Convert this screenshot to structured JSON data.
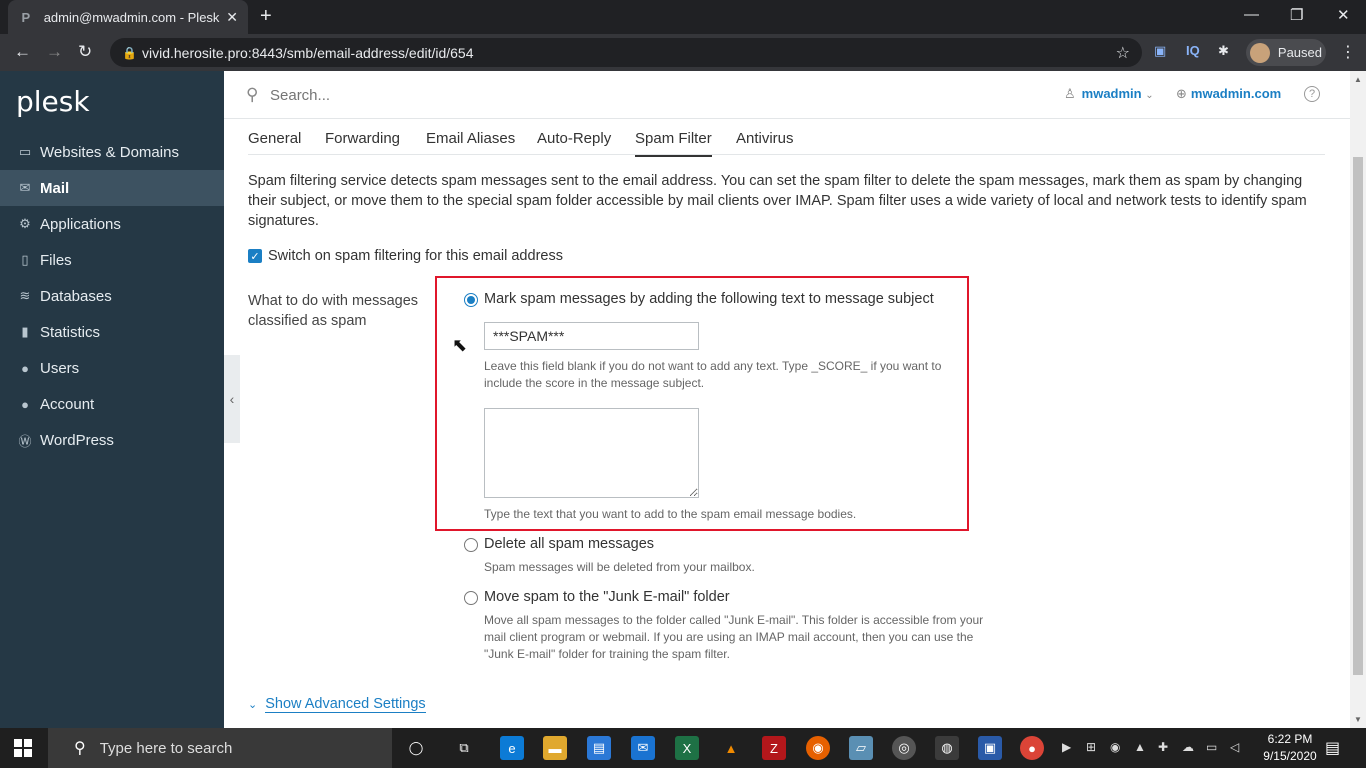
{
  "browser": {
    "tab_title": "admin@mwadmin.com - Plesk O",
    "tab_favicon": "P",
    "url": "vivid.herosite.pro:8443/smb/email-address/edit/id/654",
    "profile_status": "Paused",
    "extensions": [
      "IQ"
    ]
  },
  "sidebar": {
    "logo": "plesk",
    "items": [
      {
        "label": "Websites & Domains",
        "icon": "monitor-icon"
      },
      {
        "label": "Mail",
        "icon": "envelope-icon"
      },
      {
        "label": "Applications",
        "icon": "gear-icon"
      },
      {
        "label": "Files",
        "icon": "file-icon"
      },
      {
        "label": "Databases",
        "icon": "layers-icon"
      },
      {
        "label": "Statistics",
        "icon": "bar-chart-icon"
      },
      {
        "label": "Users",
        "icon": "user-icon"
      },
      {
        "label": "Account",
        "icon": "user-icon"
      },
      {
        "label": "WordPress",
        "icon": "wordpress-icon"
      }
    ]
  },
  "header": {
    "search_placeholder": "Search...",
    "user": "mwadmin",
    "domain": "mwadmin.com"
  },
  "page": {
    "tabs": [
      "General",
      "Forwarding",
      "Email Aliases",
      "Auto-Reply",
      "Spam Filter",
      "Antivirus"
    ],
    "active_tab": "Spam Filter",
    "description": "Spam filtering service detects spam messages sent to the email address. You can set the spam filter to delete the spam messages, mark them as spam by changing their subject, or move them to the special spam folder accessible by mail clients over IMAP. Spam filter uses a wide variety of local and network tests to identify spam signatures.",
    "switch_label": "Switch on spam filtering for this email address",
    "switch_checked": true,
    "action_label": "What to do with messages classified as spam",
    "option_mark": {
      "label": "Mark spam messages by adding the following text to message subject",
      "subject_value": "***SPAM***",
      "subject_hint": "Leave this field blank if you do not want to add any text. Type _SCORE_ if you want to include the score in the message subject.",
      "body_value": "",
      "body_hint": "Type the text that you want to add to the spam email message bodies."
    },
    "option_delete": {
      "label": "Delete all spam messages",
      "hint": "Spam messages will be deleted from your mailbox."
    },
    "option_move": {
      "label": "Move spam to the \"Junk E-mail\" folder",
      "hint": "Move all spam messages to the folder called \"Junk E-mail\". This folder is accessible from your mail client program or webmail. If you are using an IMAP mail account, then you can use the \"Junk E-mail\" folder for training the spam filter."
    },
    "advanced_link": "Show Advanced Settings"
  },
  "taskbar": {
    "search_placeholder": "Type here to search",
    "time": "6:22 PM",
    "date": "9/15/2020"
  },
  "colors": {
    "sidebar_bg": "#253845",
    "sidebar_active": "#3d5261",
    "link": "#1b7fc4",
    "highlight_box": "#e0162b"
  }
}
